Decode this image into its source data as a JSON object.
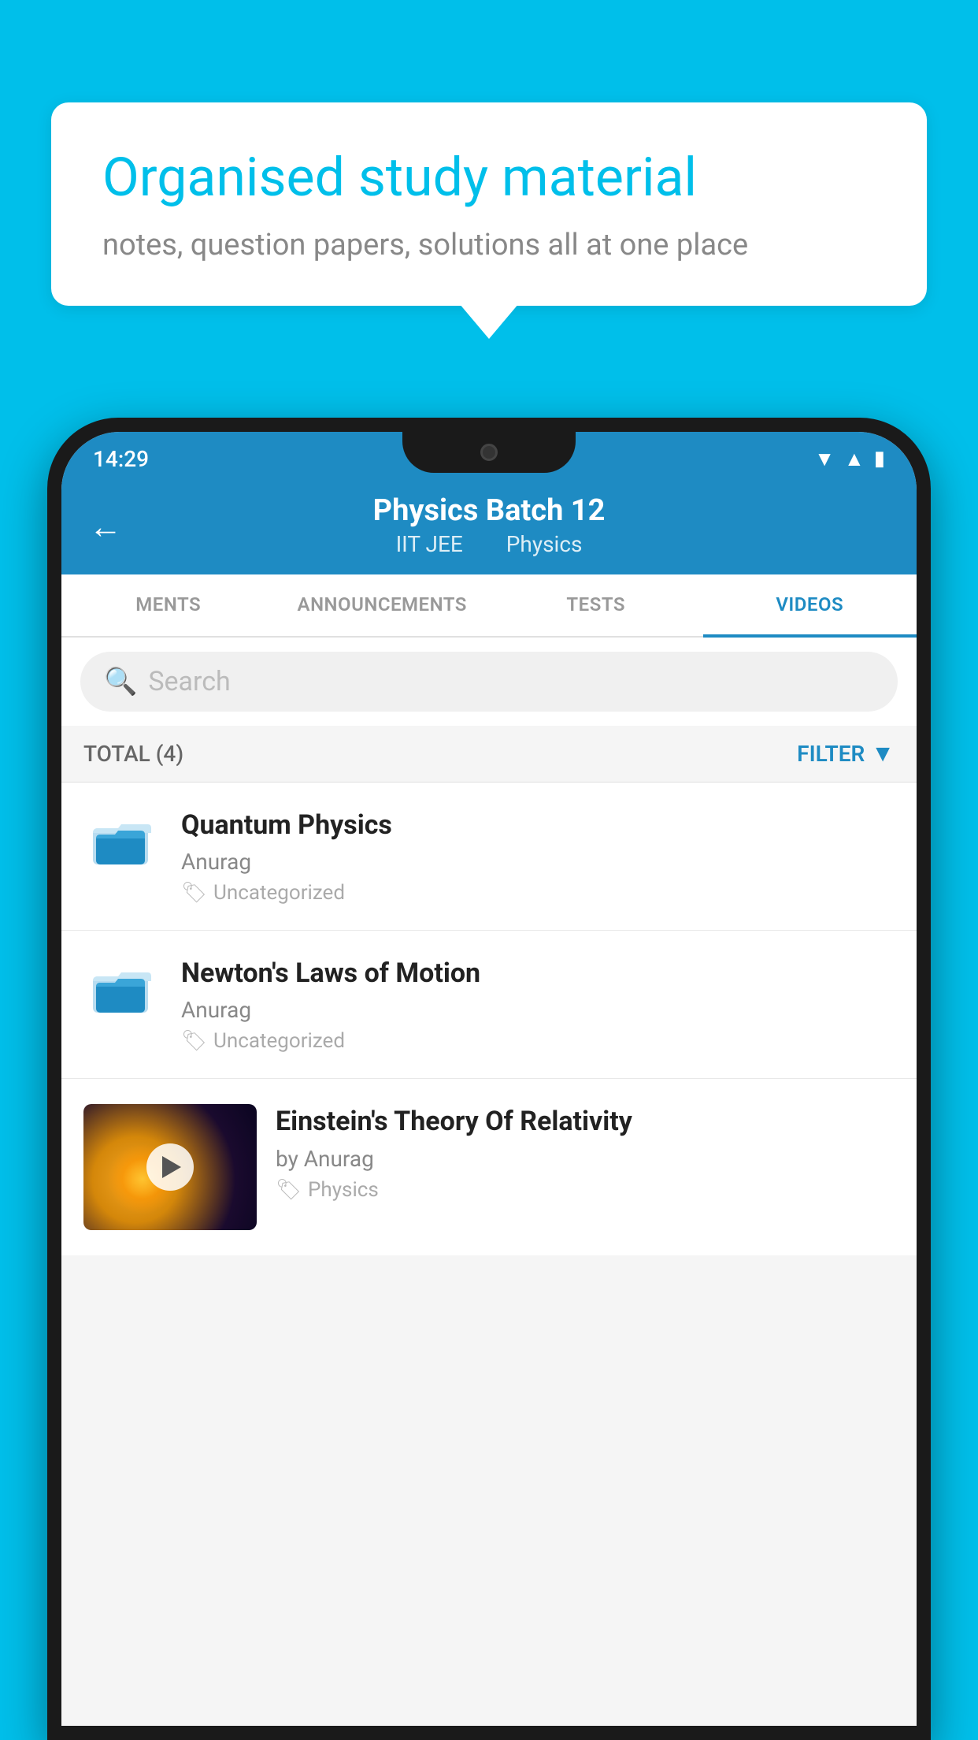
{
  "background_color": "#00BFEA",
  "speech_bubble": {
    "title": "Organised study material",
    "subtitle": "notes, question papers, solutions all at one place"
  },
  "phone": {
    "status_bar": {
      "time": "14:29",
      "icons": [
        "wifi",
        "signal",
        "battery"
      ]
    },
    "header": {
      "back_label": "←",
      "title": "Physics Batch 12",
      "subtitle_left": "IIT JEE",
      "subtitle_right": "Physics"
    },
    "tabs": [
      {
        "label": "MENTS",
        "active": false
      },
      {
        "label": "ANNOUNCEMENTS",
        "active": false
      },
      {
        "label": "TESTS",
        "active": false
      },
      {
        "label": "VIDEOS",
        "active": true
      }
    ],
    "search": {
      "placeholder": "Search"
    },
    "filter_bar": {
      "total_label": "TOTAL (4)",
      "filter_label": "FILTER"
    },
    "videos": [
      {
        "id": "v1",
        "title": "Quantum Physics",
        "author": "Anurag",
        "tag": "Uncategorized",
        "has_thumbnail": false
      },
      {
        "id": "v2",
        "title": "Newton's Laws of Motion",
        "author": "Anurag",
        "tag": "Uncategorized",
        "has_thumbnail": false
      },
      {
        "id": "v3",
        "title": "Einstein's Theory Of Relativity",
        "author": "by Anurag",
        "tag": "Physics",
        "has_thumbnail": true
      }
    ]
  }
}
